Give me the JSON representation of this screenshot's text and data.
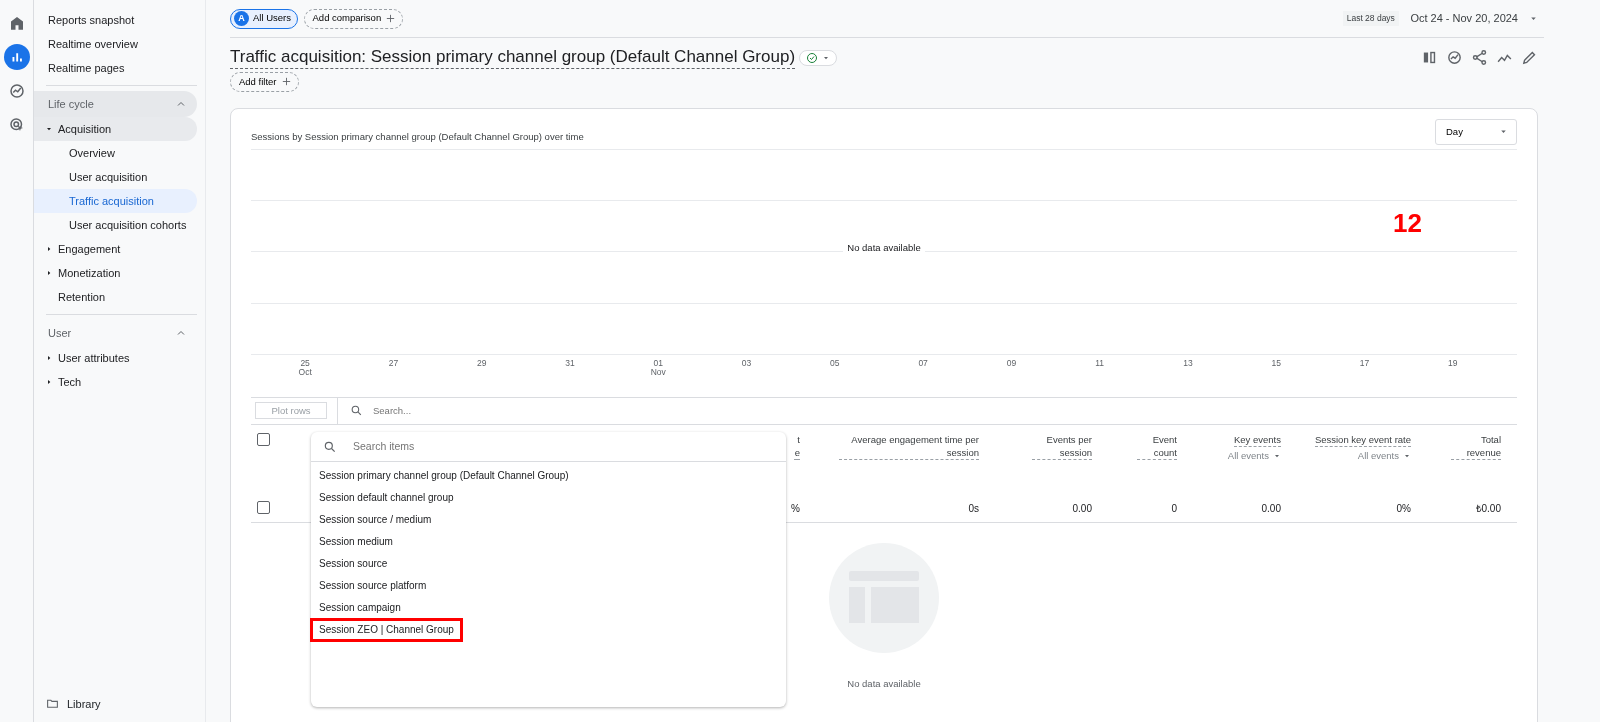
{
  "rail": [
    {
      "kind": "home",
      "selected": false
    },
    {
      "kind": "reports",
      "selected": true
    },
    {
      "kind": "explore",
      "selected": false
    },
    {
      "kind": "advertising",
      "selected": false
    }
  ],
  "sidebar": {
    "top_items": [
      {
        "label": "Reports snapshot",
        "selected": false
      },
      {
        "label": "Realtime overview",
        "selected": false
      },
      {
        "label": "Realtime pages",
        "selected": false
      }
    ],
    "sections": [
      {
        "title": "Life cycle",
        "expanded": true,
        "highlighted": true,
        "items": [
          {
            "label": "Acquisition",
            "kind": "group",
            "expanded": true,
            "children": [
              {
                "label": "Overview",
                "selected": false
              },
              {
                "label": "User acquisition",
                "selected": false
              },
              {
                "label": "Traffic acquisition",
                "selected": true
              },
              {
                "label": "User acquisition cohorts",
                "selected": false
              }
            ]
          },
          {
            "label": "Engagement",
            "kind": "group",
            "expanded": false
          },
          {
            "label": "Monetization",
            "kind": "group",
            "expanded": false
          },
          {
            "label": "Retention",
            "kind": "link"
          }
        ]
      },
      {
        "title": "User",
        "expanded": true,
        "highlighted": false,
        "items": [
          {
            "label": "User attributes",
            "kind": "group",
            "expanded": false
          },
          {
            "label": "Tech",
            "kind": "group",
            "expanded": false
          }
        ]
      }
    ],
    "footer": "Library"
  },
  "comparison": {
    "segment_letter": "A",
    "segment": "All Users",
    "add_label": "Add comparison"
  },
  "date_range": {
    "preset": "Last 28 days",
    "range": "Oct 24 - Nov 20, 2024"
  },
  "report": {
    "title": "Traffic acquisition: Session primary channel group (Default Channel Group)",
    "add_filter": "Add filter"
  },
  "chart_card": {
    "title": "Sessions by Session primary channel group (Default Channel Group) over time",
    "granularity": "Day",
    "empty_message": "No data available",
    "annotation": "12",
    "x_labels": [
      {
        "day": "25",
        "month": "Oct"
      },
      {
        "day": "27"
      },
      {
        "day": "29"
      },
      {
        "day": "31"
      },
      {
        "day": "01",
        "month": "Nov"
      },
      {
        "day": "03"
      },
      {
        "day": "05"
      },
      {
        "day": "07"
      },
      {
        "day": "09"
      },
      {
        "day": "11"
      },
      {
        "day": "13"
      },
      {
        "day": "15"
      },
      {
        "day": "17"
      },
      {
        "day": "19"
      }
    ]
  },
  "table": {
    "plot_rows": "Plot rows",
    "search_placeholder": "Search...",
    "header_checked": false,
    "columns": [
      {
        "header": "t e",
        "value": "%"
      },
      {
        "header": "Average engagement time per session",
        "value": "0s"
      },
      {
        "header": "Events per session",
        "value": "0.00"
      },
      {
        "header": "Event count",
        "value": "0"
      },
      {
        "header": "Key events",
        "filter": "All events",
        "value": "0.00"
      },
      {
        "header": "Session key event rate",
        "filter": "All events",
        "value": "0%"
      },
      {
        "header": "Total revenue",
        "value": "₺0.00"
      }
    ],
    "row_checked": false,
    "empty_message": "No data available"
  },
  "dimension_menu": {
    "search_placeholder": "Search items",
    "items": [
      {
        "label": "Session primary channel group (Default Channel Group)",
        "highlighted": false
      },
      {
        "label": "Session default channel group",
        "highlighted": false
      },
      {
        "label": "Session source / medium",
        "highlighted": false
      },
      {
        "label": "Session medium",
        "highlighted": false
      },
      {
        "label": "Session source",
        "highlighted": false
      },
      {
        "label": "Session source platform",
        "highlighted": false
      },
      {
        "label": "Session campaign",
        "highlighted": false
      },
      {
        "label": "Session ZEO | Channel Group",
        "highlighted": true
      }
    ]
  }
}
